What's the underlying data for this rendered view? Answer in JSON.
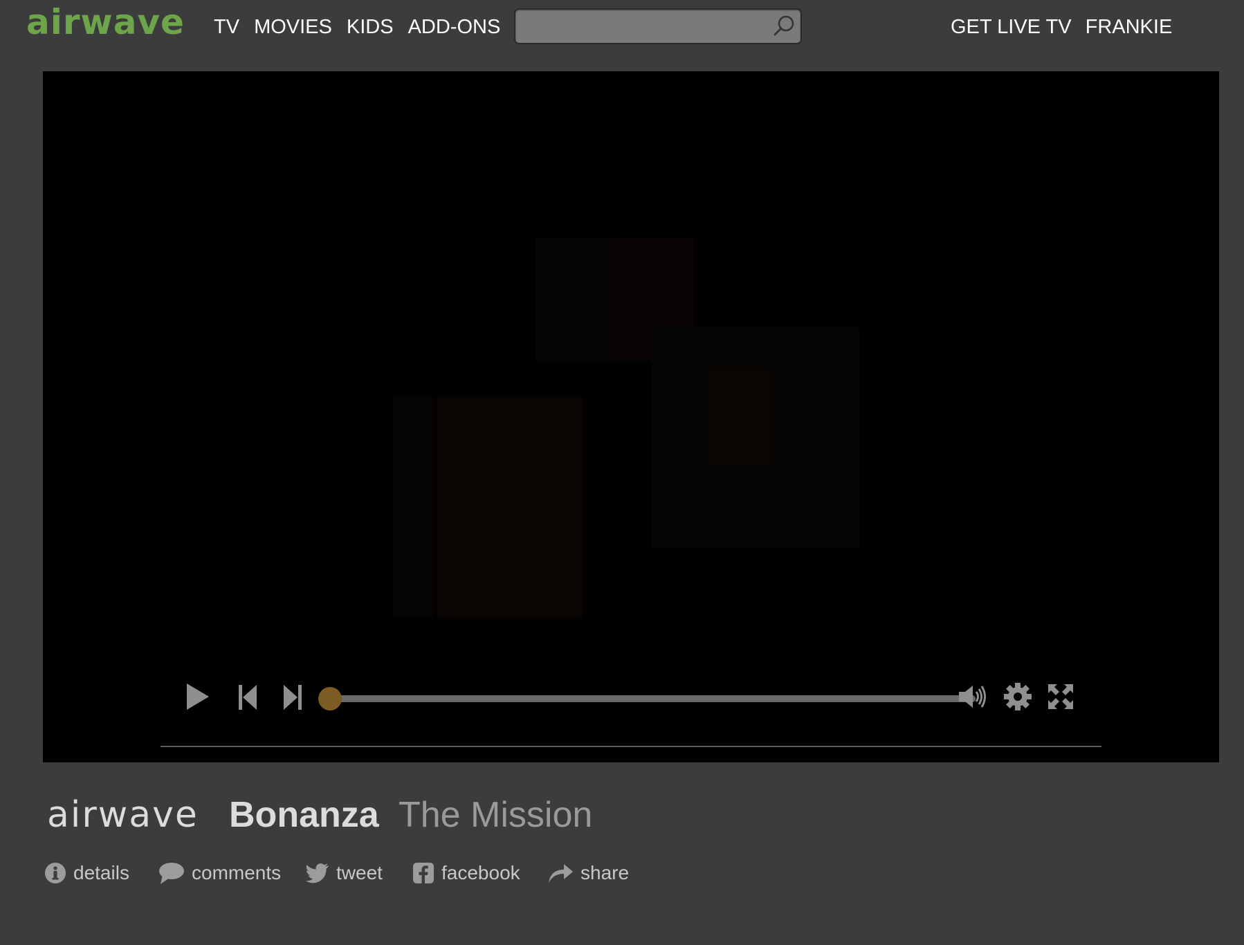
{
  "header": {
    "logo": "airwave",
    "nav": [
      "TV",
      "MOVIES",
      "KIDS",
      "ADD-ONS"
    ],
    "search": {
      "value": "",
      "placeholder": ""
    },
    "right_nav": [
      "GET LIVE TV",
      "FRANKIE"
    ]
  },
  "player": {
    "progress": 0,
    "controls": [
      "play",
      "previous",
      "next",
      "volume",
      "settings",
      "fullscreen"
    ]
  },
  "info": {
    "brand": "airwave",
    "show_title": "Bonanza",
    "episode_title": "The Mission"
  },
  "actions": [
    "details",
    "comments",
    "tweet",
    "facebook",
    "share"
  ],
  "colors": {
    "background": "#3c3c3c",
    "logo_green": "#6da64a",
    "progress_knob": "#7c5b24",
    "player_bg": "#000000"
  }
}
